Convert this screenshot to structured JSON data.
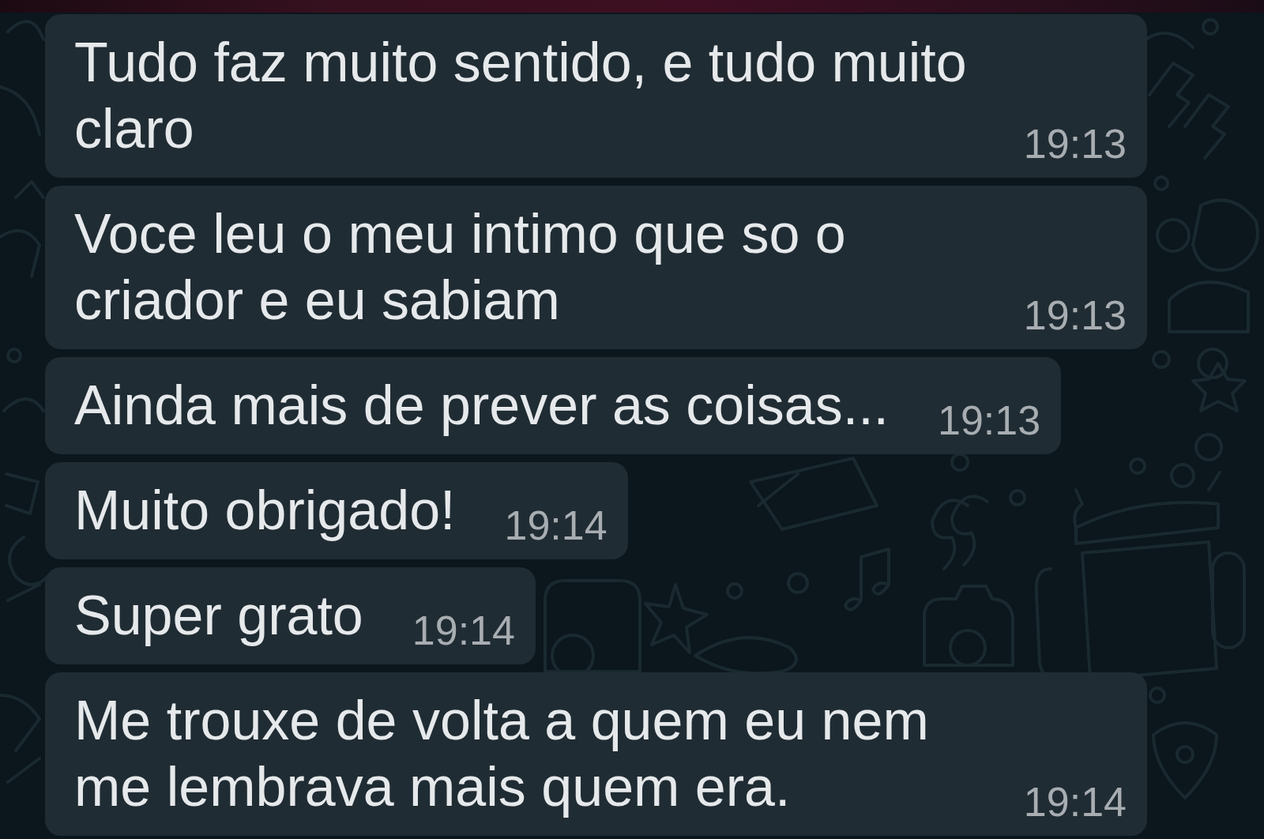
{
  "messages": [
    {
      "text": "Tudo faz muito sentido, e tudo muito claro",
      "time": "19:13"
    },
    {
      "text": "Voce leu o meu intimo que so o criador e eu sabiam",
      "time": "19:13"
    },
    {
      "text": "Ainda mais de prever as coisas...",
      "time": "19:13"
    },
    {
      "text": "Muito obrigado!",
      "time": "19:14"
    },
    {
      "text": "Super grato",
      "time": "19:14"
    },
    {
      "text": "Me trouxe de volta a quem eu nem me lembrava mais quem era.",
      "time": "19:14"
    }
  ]
}
